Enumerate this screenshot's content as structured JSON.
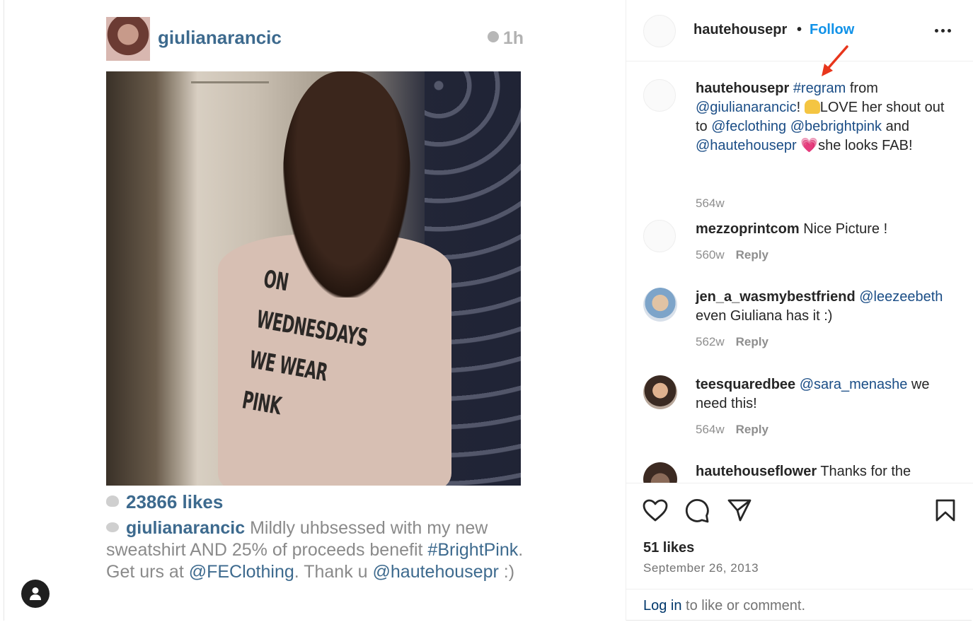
{
  "embedded_post": {
    "username": "giulianarancic",
    "time": "1h",
    "shirt_line1": "ON WEDNESDAYS",
    "shirt_line2": "WE WEAR PINK",
    "likes": "23866 likes",
    "caption_user": "giulianarancic",
    "caption_p1": "Mildly uhbsessed with my new sweatshirt AND 25% of proceeds benefit",
    "caption_tag": "#BrightPink",
    "caption_p2": ". Get urs at",
    "caption_mention1": "@FEClothing",
    "caption_p3": ". Thank u",
    "caption_mention2": "@hautehousepr",
    "caption_end": " :)"
  },
  "header": {
    "username": "hautehousepr",
    "dot": "•",
    "follow_label": "Follow"
  },
  "comments": [
    {
      "user": "hautehousepr",
      "hashtag": "#regram",
      "t1": " from ",
      "m1": "@giulianarancic",
      "t2": "! ",
      "t3": "LOVE her shout out to ",
      "m2": "@feclothing",
      "m3": "@bebrightpink",
      "t4": " and ",
      "m4": "@hautehousepr",
      "t5": "she looks FAB!",
      "time": "564w"
    },
    {
      "user": "mezzoprintcom",
      "text": " Nice Picture !",
      "time": "560w",
      "reply": "Reply"
    },
    {
      "user": "jen_a_wasmybestfriend",
      "mention": "@leezeebeth",
      "text": "even Giuliana has it :)",
      "time": "562w",
      "reply": "Reply"
    },
    {
      "user": "teesquaredbee",
      "mention": "@sara_menashe",
      "text": " we need this!",
      "time": "564w",
      "reply": "Reply"
    },
    {
      "user": "hautehouseflower",
      "text": " Thanks for the"
    }
  ],
  "footer": {
    "likes": "51 likes",
    "date": "September 26, 2013",
    "login_link": "Log in",
    "login_text": " to like or comment."
  },
  "icons": [
    "heart-icon",
    "comment-icon",
    "share-icon",
    "bookmark-icon",
    "more-icon",
    "profile-icon",
    "clock-icon"
  ],
  "colors": {
    "link": "#1192e8",
    "mention": "#1a4d86",
    "muted": "#8e8e8e",
    "annotation_arrow": "#e8361c"
  }
}
